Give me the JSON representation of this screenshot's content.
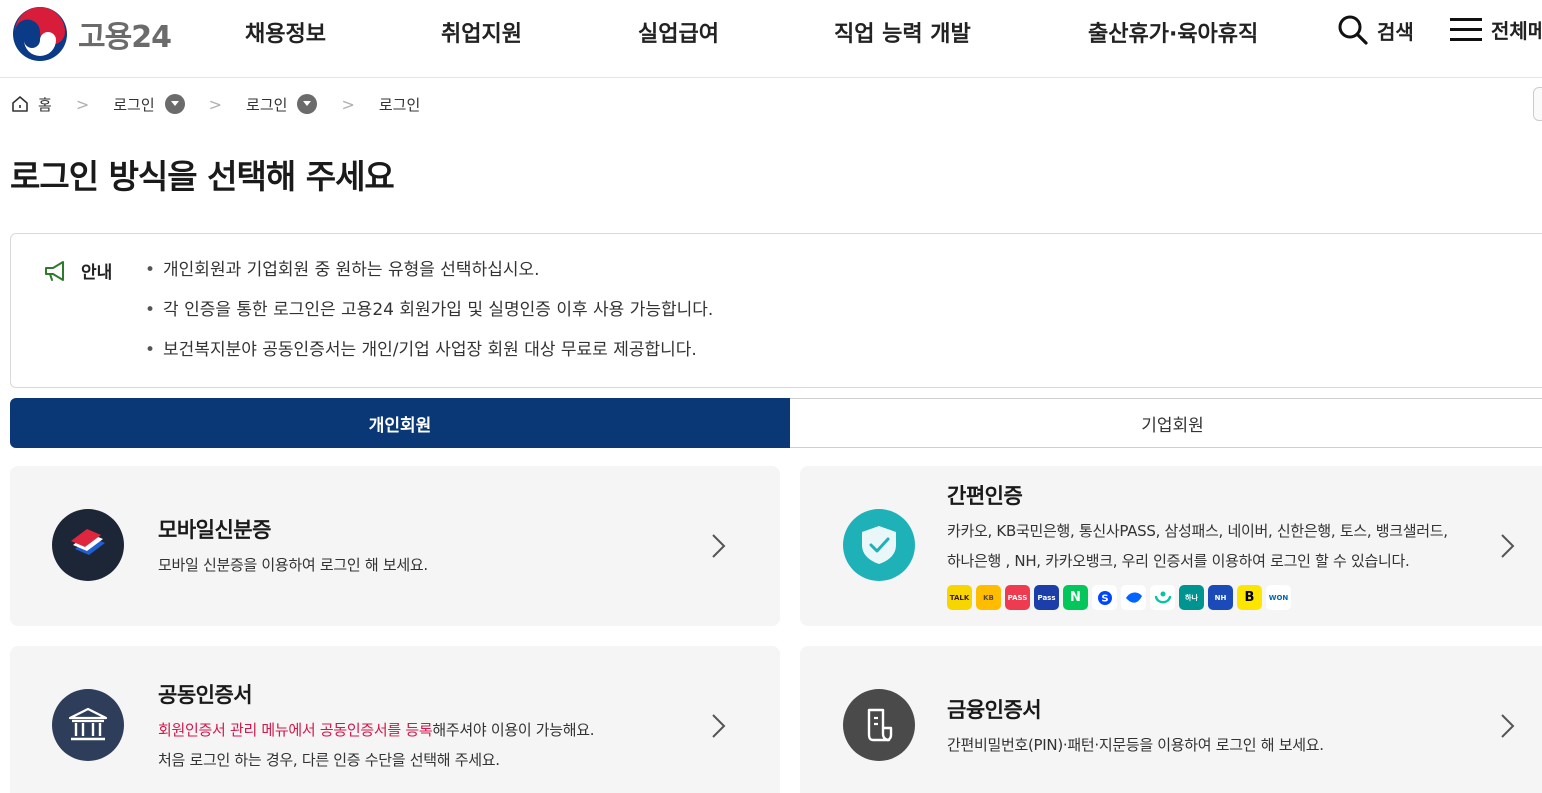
{
  "header": {
    "logo_text": "고용24",
    "nav": [
      "채용정보",
      "취업지원",
      "실업급여",
      "직업 능력 개발",
      "출산휴가·육아휴직"
    ],
    "search_label": "검색",
    "menu_label": "전체메뉴"
  },
  "breadcrumb": {
    "home": "홈",
    "items": [
      "로그인",
      "로그인",
      "로그인"
    ]
  },
  "page_title": "로그인 방식을 선택해 주세요",
  "notice": {
    "label": "안내",
    "items": [
      "개인회원과 기업회원 중 원하는 유형을 선택하십시오.",
      "각 인증을 통한 로그인은 고용24 회원가입 및 실명인증 이후 사용 가능합니다.",
      "보건복지분야 공동인증서는 개인/기업 사업장 회원 대상 무료로 제공합니다."
    ]
  },
  "tabs": [
    {
      "label": "개인회원",
      "active": true
    },
    {
      "label": "기업회원",
      "active": false
    }
  ],
  "cards": {
    "mobile_id": {
      "title": "모바일신분증",
      "desc": "모바일 신분증을 이용하여 로그인 해 보세요.",
      "icon": "mobile-id-icon"
    },
    "simple_auth": {
      "title": "간편인증",
      "desc": "카카오, KB국민은행, 통신사PASS, 삼성패스, 네이버, 신한은행, 토스, 뱅크샐러드, 하나은행 , NH, 카카오뱅크, 우리 인증서를 이용하여 로그인 할 수 있습니다.",
      "icon": "shield-check-icon",
      "providers": [
        {
          "name": "kakao-talk",
          "text": "TALK",
          "color": "#f7d600",
          "fg": "#3a1d1d"
        },
        {
          "name": "kb",
          "text": "KB",
          "color": "#ffbc00",
          "fg": "#5a4a33"
        },
        {
          "name": "pass",
          "text": "PASS",
          "color": "#ee3b4f",
          "fg": "#ffffff"
        },
        {
          "name": "samsung-pass",
          "text": "Pass",
          "color": "#1b3ea8",
          "fg": "#ffffff"
        },
        {
          "name": "naver",
          "text": "N",
          "color": "#03c75a",
          "fg": "#ffffff"
        },
        {
          "name": "shinhan",
          "text": "S",
          "color": "#ffffff",
          "fg": "#0046ff"
        },
        {
          "name": "toss",
          "text": "",
          "color": "#ffffff",
          "fg": "#0064ff"
        },
        {
          "name": "banksalad",
          "text": "",
          "color": "#ffffff",
          "fg": "#08c4a7"
        },
        {
          "name": "hana",
          "text": "하나",
          "color": "#009490",
          "fg": "#ffffff"
        },
        {
          "name": "nh",
          "text": "NH",
          "color": "#1a4bb8",
          "fg": "#ffffff"
        },
        {
          "name": "kakaobank",
          "text": "B",
          "color": "#fee500",
          "fg": "#000000"
        },
        {
          "name": "woori",
          "text": "WON",
          "color": "#ffffff",
          "fg": "#0067ac"
        }
      ]
    },
    "joint_cert": {
      "title": "공동인증서",
      "desc_em": "회원인증서 관리 메뉴에서 공동인증서를 등록",
      "desc_rest": "해주셔야 이용이 가능해요.",
      "desc2": "처음 로그인 하는 경우, 다른 인증 수단을 선택해 주세요.",
      "icon": "bank-icon"
    },
    "financial_cert": {
      "title": "금융인증서",
      "desc": "간편비밀번호(PIN)·패턴·지문등을 이용하여 로그인 해 보세요.",
      "icon": "document-icon"
    }
  },
  "colors": {
    "primary": "#0a3877",
    "accent_teal": "#1fb1b8",
    "emphasis": "#d6174b",
    "card_bg": "#f5f5f5"
  }
}
